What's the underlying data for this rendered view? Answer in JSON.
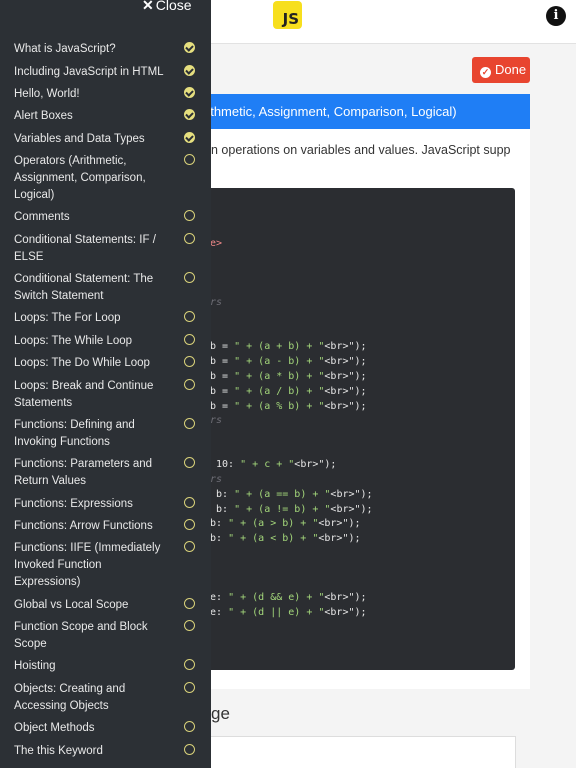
{
  "header": {
    "logo_text": "JS",
    "info_icon": "i"
  },
  "done_button": {
    "label": "Done"
  },
  "lesson": {
    "title_fragment": "rithmetic, Assignment, Comparison, Logical)",
    "intro_fragment": "n operations on variables and values. JavaScript supports"
  },
  "code_lines": [
    {
      "t": "e>",
      "c": "tag"
    },
    {
      "t": "rs",
      "c": "com"
    },
    {
      "t": "b = \" + (a + b) + \"<br>\");",
      "c": ""
    },
    {
      "t": "b = \" + (a - b) + \"<br>\");",
      "c": ""
    },
    {
      "t": "b = \" + (a * b) + \"<br>\");",
      "c": ""
    },
    {
      "t": "b = \" + (a / b) + \"<br>\");",
      "c": ""
    },
    {
      "t": "b = \" + (a % b) + \"<br>\");",
      "c": ""
    },
    {
      "t": "rs",
      "c": "com"
    },
    {
      "t": " 10: \" + c + \"<br>\");",
      "c": ""
    },
    {
      "t": "rs",
      "c": "com"
    },
    {
      "t": " b: \" + (a == b) + \"<br>\");",
      "c": ""
    },
    {
      "t": " b: \" + (a != b) + \"<br>\");",
      "c": ""
    },
    {
      "t": "b: \" + (a > b) + \"<br>\");",
      "c": ""
    },
    {
      "t": "b: \" + (a < b) + \"<br>\");",
      "c": ""
    },
    {
      "t": "e: \" + (d && e) + \"<br>\");",
      "c": ""
    },
    {
      "t": "e: \" + (d || e) + \"<br>\");",
      "c": ""
    }
  ],
  "section_title_fragment": "ge",
  "sidebar": {
    "close_label": "Close",
    "items": [
      {
        "label": "What is JavaScript?",
        "status": "done"
      },
      {
        "label": "Including JavaScript in HTML",
        "status": "done"
      },
      {
        "label": "Hello, World!",
        "status": "done"
      },
      {
        "label": "Alert Boxes",
        "status": "done"
      },
      {
        "label": "Variables and Data Types",
        "status": "done"
      },
      {
        "label": "Operators (Arithmetic, Assignment, Comparison, Logical)",
        "status": "todo"
      },
      {
        "label": "Comments",
        "status": "todo"
      },
      {
        "label": "Conditional Statements: IF / ELSE",
        "status": "todo"
      },
      {
        "label": "Conditional Statement: The Switch Statement",
        "status": "todo"
      },
      {
        "label": "Loops: The For Loop",
        "status": "todo"
      },
      {
        "label": "Loops: The While Loop",
        "status": "todo"
      },
      {
        "label": "Loops: The Do While Loop",
        "status": "todo"
      },
      {
        "label": "Loops: Break and Continue Statements",
        "status": "todo"
      },
      {
        "label": "Functions: Defining and Invoking Functions",
        "status": "todo"
      },
      {
        "label": "Functions: Parameters and Return Values",
        "status": "todo"
      },
      {
        "label": "Functions: Expressions",
        "status": "todo"
      },
      {
        "label": "Functions: Arrow Functions",
        "status": "todo"
      },
      {
        "label": "Functions: IIFE (Immediately Invoked Function Expressions)",
        "status": "todo"
      },
      {
        "label": "Global vs Local Scope",
        "status": "todo"
      },
      {
        "label": "Function Scope and Block Scope",
        "status": "todo"
      },
      {
        "label": "Hoisting",
        "status": "todo"
      },
      {
        "label": "Objects: Creating and Accessing Objects",
        "status": "todo"
      },
      {
        "label": "Object Methods",
        "status": "todo"
      },
      {
        "label": "The this Keyword",
        "status": "todo"
      }
    ]
  }
}
